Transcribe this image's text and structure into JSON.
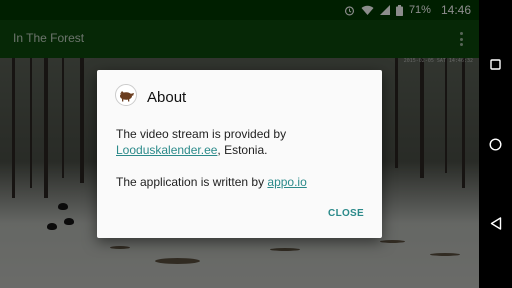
{
  "status_bar": {
    "battery": "71%",
    "time": "14:46",
    "icons": [
      "alarm-icon",
      "wifi-icon",
      "signal-icon",
      "battery-icon"
    ]
  },
  "app_bar": {
    "title": "In The Forest",
    "menu_icon": "overflow-menu-icon"
  },
  "video": {
    "timestamp": "2015-02-05 SAT 14:46:32"
  },
  "dialog": {
    "title": "About",
    "icon": "wild-boar-logo",
    "line1_text": "The video stream is provided by",
    "line1_link": "Looduskalender.ee",
    "line1_suffix": ", Estonia.",
    "line2_text": "The application is written by ",
    "line2_link": "appo.io",
    "close_label": "CLOSE"
  },
  "nav_bar": {
    "buttons": [
      "recents-button",
      "home-button",
      "back-button"
    ]
  },
  "colors": {
    "status_bar": "#003a00",
    "app_bar": "#0c4a0c",
    "accent": "#2b8a8a"
  }
}
